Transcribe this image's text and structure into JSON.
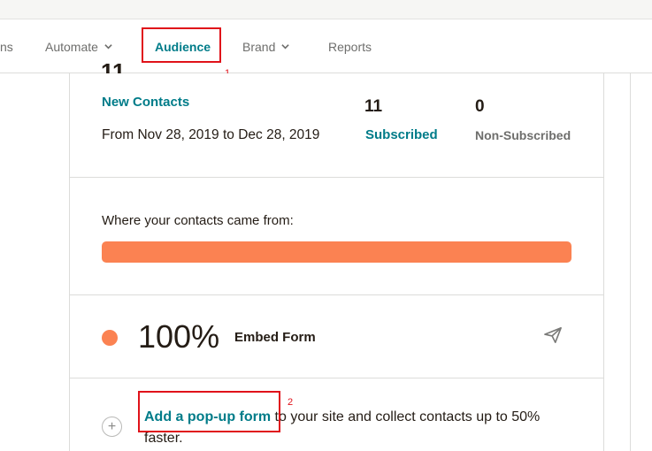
{
  "nav": {
    "items": [
      {
        "label": "ns"
      },
      {
        "label": "Automate"
      },
      {
        "label": "Audience"
      },
      {
        "label": "Brand"
      },
      {
        "label": "Reports"
      }
    ]
  },
  "annotations": {
    "one": "1",
    "two": "2"
  },
  "summary": {
    "new_contacts_label": "New Contacts",
    "date_range": "From Nov 28, 2019 to Dec 28, 2019",
    "subscribed_count": "11",
    "subscribed_label": "Subscribed",
    "non_subscribed_count": "0",
    "non_subscribed_label": "Non-Subscribed"
  },
  "sources": {
    "heading": "Where your contacts came from:",
    "bar_fill_fraction": 1.0,
    "items": [
      {
        "percent": "100%",
        "name": "Embed Form",
        "color": "#fb8252"
      }
    ]
  },
  "tip": {
    "link_text": "Add a pop-up form",
    "rest_text": " to your site and collect contacts up to 50% faster."
  },
  "colors": {
    "accent": "#007c89",
    "source_orange": "#fb8252",
    "annotation_red": "#e0121a"
  },
  "icons": {
    "plus": "plus-circle-icon",
    "send": "paper-plane-icon",
    "chevron": "chevron-down-icon"
  }
}
